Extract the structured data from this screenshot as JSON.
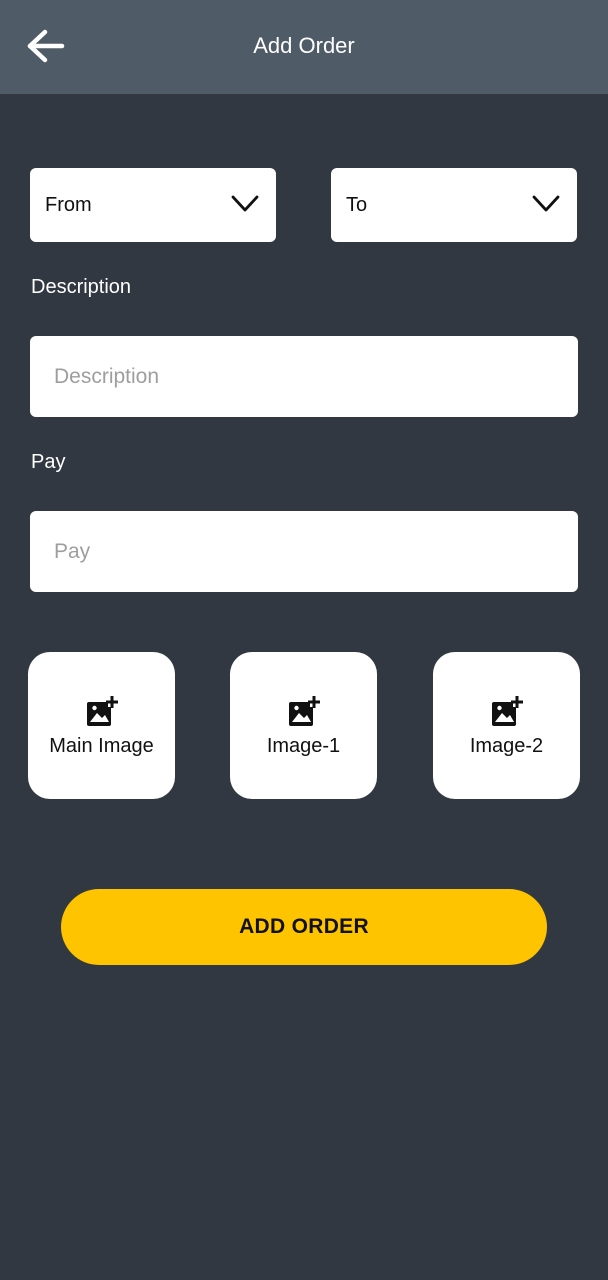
{
  "appbar": {
    "title": "Add Order",
    "back_icon": "arrow-left-icon"
  },
  "route": {
    "from_label": "From",
    "to_label": "To",
    "dropdown_icon": "chevron-down-icon"
  },
  "description": {
    "label": "Description",
    "placeholder": "Description",
    "value": ""
  },
  "pay": {
    "label": "Pay",
    "placeholder": "Pay",
    "value": ""
  },
  "images": {
    "icon": "add-photo-icon",
    "tiles": [
      {
        "label": "Main Image"
      },
      {
        "label": "Image-1"
      },
      {
        "label": "Image-2"
      }
    ]
  },
  "submit": {
    "label": "ADD ORDER"
  },
  "colors": {
    "background": "#323841",
    "appbar": "#4f5b66",
    "accent": "#ffc400",
    "surface": "#ffffff"
  }
}
